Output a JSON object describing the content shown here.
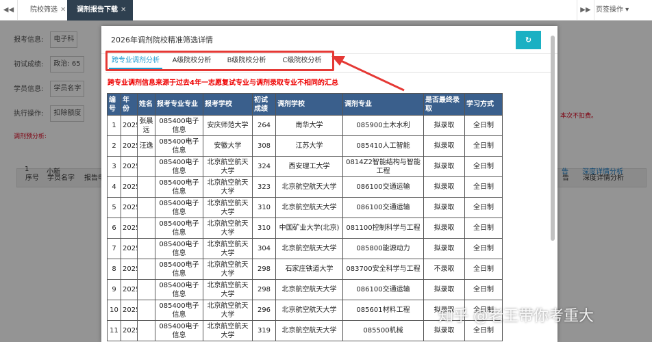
{
  "topbar": {
    "nav_left": "◀◀",
    "nav_right": "▶▶",
    "tabs": [
      {
        "label": "院校筛选",
        "close": "✕"
      },
      {
        "label": "调剂报告下载",
        "close": "✕"
      }
    ],
    "page_ops": "页签操作 ▾"
  },
  "background": {
    "rows": [
      {
        "label": "报考信息:",
        "field": "电子科"
      },
      {
        "label": "初试成绩:",
        "field": "政治: 65"
      },
      {
        "label": "学员信息:",
        "field": "学员名字"
      },
      {
        "label": "执行操作:",
        "field": "扣除额度"
      }
    ],
    "red_note": "本次不扣费。",
    "section_label": "调剂预分析:",
    "table_headers": [
      "序号",
      "学员名字",
      "报告申请",
      "告",
      "深度详情分析"
    ],
    "table_row": {
      "index": "1",
      "name": "小新",
      "link1": "告",
      "link2": "深度详情分析"
    }
  },
  "modal": {
    "title": "2026年调剂院校精准筛选详情",
    "refresh_icon": "↻",
    "tabs": [
      "跨专业调剂分析",
      "A级院校分析",
      "B级院校分析",
      "C级院校分析"
    ],
    "note": "跨专业调剂信息来源于过去4年一志愿复试专业与调剂录取专业不相同的汇总",
    "table": {
      "headers": [
        "编号",
        "年份",
        "姓名",
        "报考专业专业",
        "报考学校",
        "初试成绩",
        "调剂学校",
        "调剂专业",
        "是否最终录取",
        "学习方式"
      ],
      "rows": [
        [
          "1",
          "2025",
          "张晨远",
          "085400电子信息",
          "安庆师范大学",
          "264",
          "南华大学",
          "085900土木水利",
          "拟录取",
          "全日制"
        ],
        [
          "2",
          "2025",
          "汪逸",
          "085400电子信息",
          "安徽大学",
          "308",
          "江苏大学",
          "085410人工智能",
          "拟录取",
          "全日制"
        ],
        [
          "3",
          "2025",
          "",
          "085400电子信息",
          "北京航空航天大学",
          "324",
          "西安理工大学",
          "0814Z2智能结构与智能工程",
          "拟录取",
          "全日制"
        ],
        [
          "4",
          "2025",
          "",
          "085400电子信息",
          "北京航空航天大学",
          "323",
          "北京航空航天大学",
          "086100交通运输",
          "拟录取",
          "全日制"
        ],
        [
          "5",
          "2025",
          "",
          "085400电子信息",
          "北京航空航天大学",
          "310",
          "北京航空航天大学",
          "086100交通运输",
          "拟录取",
          "全日制"
        ],
        [
          "6",
          "2025",
          "",
          "085400电子信息",
          "北京航空航天大学",
          "310",
          "中国矿业大学(北京)",
          "081100控制科学与工程",
          "拟录取",
          "全日制"
        ],
        [
          "7",
          "2025",
          "",
          "085400电子信息",
          "北京航空航天大学",
          "304",
          "北京航空航天大学",
          "085800能源动力",
          "拟录取",
          "全日制"
        ],
        [
          "8",
          "2025",
          "",
          "085400电子信息",
          "北京航空航天大学",
          "298",
          "石家庄铁道大学",
          "083700安全科学与工程",
          "不录取",
          "全日制"
        ],
        [
          "9",
          "2025",
          "",
          "085400电子信息",
          "北京航空航天大学",
          "298",
          "北京航空航天大学",
          "086100交通运输",
          "拟录取",
          "全日制"
        ],
        [
          "10",
          "2025",
          "",
          "085400电子信息",
          "北京航空航天大学",
          "296",
          "北京航空航天大学",
          "085601材料工程",
          "拟录取",
          "全日制"
        ],
        [
          "11",
          "2025",
          "",
          "085400电子信息",
          "北京航空航天大学",
          "319",
          "北京航空航天大学",
          "085500机械",
          "拟录取",
          "全日制"
        ]
      ]
    }
  },
  "watermark": "知乎 @老王带你考重大",
  "colors": {
    "accent": "#1ab0c3",
    "tab_active": "#1e9bd1",
    "header": "#3a5f8c",
    "highlight": "#e53935",
    "dark_tab": "#2f4050"
  }
}
